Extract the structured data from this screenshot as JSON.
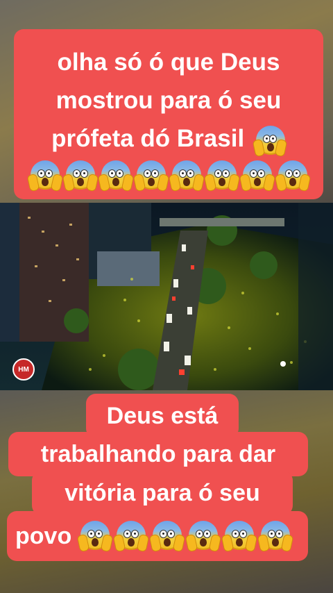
{
  "top_caption": {
    "line1": "olha só ó que Deus",
    "line2": "mostrou para ó seu",
    "line3": "prófeta dó Brasil",
    "line3_emoji": "face-screaming-in-fear",
    "emoji_row_icon": "face-screaming-in-fear"
  },
  "photo": {
    "description_icon": "aerial-crowd-night-photo",
    "watermark": "HM"
  },
  "bottom_caption": {
    "line1": "Deus está",
    "line2": "trabalhando para dar",
    "line3": "vitória para ó seu",
    "line4": "povo",
    "line4_emoji": "face-screaming-in-fear"
  },
  "colors": {
    "caption_bg": "#f05050",
    "caption_text": "#ffffff"
  }
}
